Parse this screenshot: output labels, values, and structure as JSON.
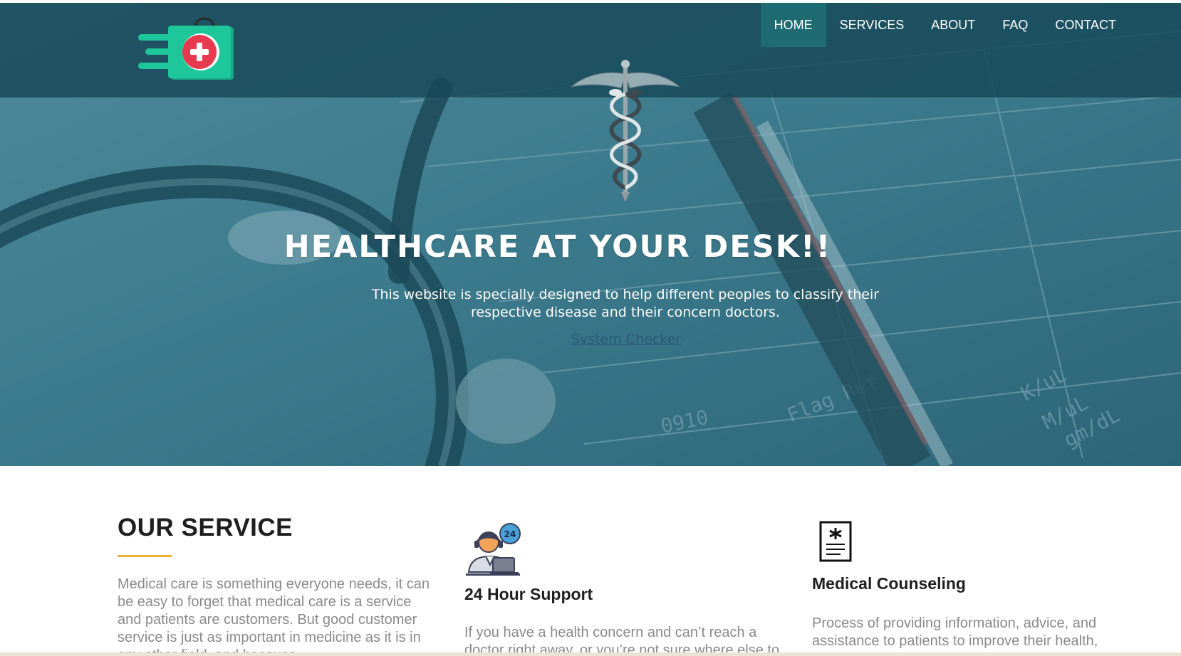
{
  "nav": {
    "items": [
      {
        "label": "HOME",
        "active": true
      },
      {
        "label": "SERVICES",
        "active": false
      },
      {
        "label": "ABOUT",
        "active": false
      },
      {
        "label": "FAQ",
        "active": false
      },
      {
        "label": "CONTACT",
        "active": false
      }
    ]
  },
  "logo": {
    "icon": "medical-bag-icon"
  },
  "hero": {
    "title": "HEALTHCARE AT YOUR DESK!!",
    "text": "This website is specially designed to help different peoples to classify their respective disease and their concern doctors.",
    "link_label": "System Checker"
  },
  "services": {
    "title": "OUR SERVICE",
    "intro": "Medical care is something everyone needs, it can be easy to forget that medical care is a service and patients are customers. But good customer service is just as important in medicine as it is in any other field, and because",
    "cards": [
      {
        "icon": "support-agent-24-icon",
        "title": "24 Hour Support",
        "text": "If you have a health concern and can’t reach a doctor right away, or you’re not sure where else to"
      },
      {
        "icon": "medical-document-icon",
        "title": "Medical Counseling",
        "text": "Process of providing information, advice, and assistance to patients to improve their health, emotional well-being, and quality of life. By"
      }
    ]
  },
  "colors": {
    "nav_bg": "#164858",
    "nav_active": "#1f6b73",
    "hero_overlay": "#2d6e80",
    "accent_underline": "#f0b03a",
    "logo_green": "#1ec79a",
    "logo_red": "#e83a4e"
  }
}
